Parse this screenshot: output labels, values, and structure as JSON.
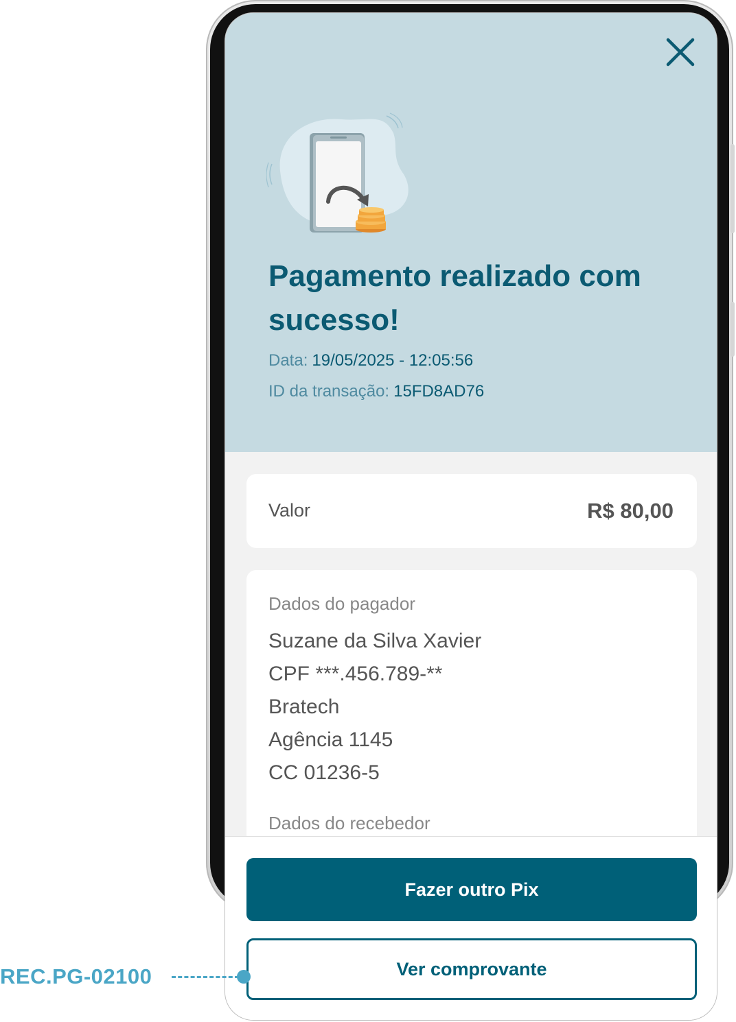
{
  "header": {
    "title": "Pagamento realizado com sucesso!",
    "date_label": "Data:",
    "date_value": "19/05/2025 - 12:05:56",
    "txid_label": "ID da transação:",
    "txid_value": "15FD8AD76",
    "close_icon": "close-icon",
    "illustration_icon": "phone-payment-coins-illustration"
  },
  "amount": {
    "label": "Valor",
    "value": "R$ 80,00"
  },
  "payer": {
    "section_label": "Dados do pagador",
    "lines": [
      "Suzane da Silva Xavier",
      "CPF ***.456.789-**",
      "Bratech",
      "Agência 1145",
      "CC 01236-5"
    ]
  },
  "receiver": {
    "section_label": "Dados do recebedor"
  },
  "actions": {
    "primary_label": "Fazer outro Pix",
    "secondary_label": "Ver comprovante"
  },
  "annotation": {
    "code": "REC.PG-02100"
  },
  "colors": {
    "brand": "#006078",
    "title": "#0b5a72",
    "header_bg": "#c5dae1",
    "annotation": "#4aa6c6"
  }
}
